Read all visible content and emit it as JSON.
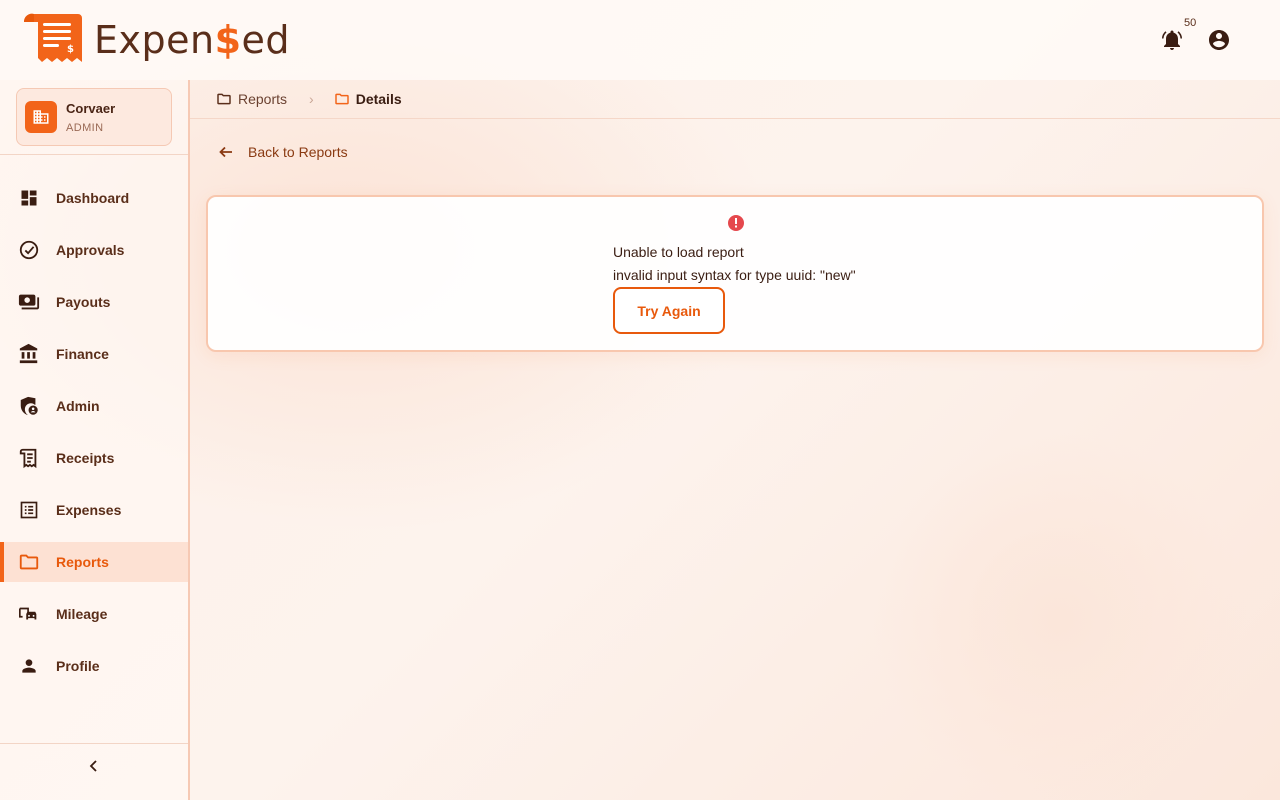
{
  "app": {
    "logo_text_before": "Expen",
    "logo_text_symbol": "$",
    "logo_text_after": "ed",
    "brand_color": "#f26419"
  },
  "header": {
    "notification_count": "50",
    "notification_icon": "bell-icon",
    "account_icon": "account-circle-icon"
  },
  "org": {
    "name": "Corvaer",
    "role": "ADMIN"
  },
  "sidebar": {
    "items": [
      {
        "label": "Dashboard",
        "icon": "dashboard-icon"
      },
      {
        "label": "Approvals",
        "icon": "check-circle-icon"
      },
      {
        "label": "Payouts",
        "icon": "payments-icon"
      },
      {
        "label": "Finance",
        "icon": "bank-icon"
      },
      {
        "label": "Admin",
        "icon": "admin-shield-icon"
      },
      {
        "label": "Receipts",
        "icon": "receipt-icon"
      },
      {
        "label": "Expenses",
        "icon": "list-icon"
      },
      {
        "label": "Reports",
        "icon": "folder-icon",
        "active": true
      },
      {
        "label": "Mileage",
        "icon": "car-icon"
      },
      {
        "label": "Profile",
        "icon": "person-icon"
      }
    ]
  },
  "breadcrumb": {
    "parent": "Reports",
    "current": "Details"
  },
  "main": {
    "back_label": "Back to Reports",
    "error_title": "Unable to load report",
    "error_message": "invalid input syntax for type uuid: \"new\"",
    "retry_label": "Try Again"
  }
}
